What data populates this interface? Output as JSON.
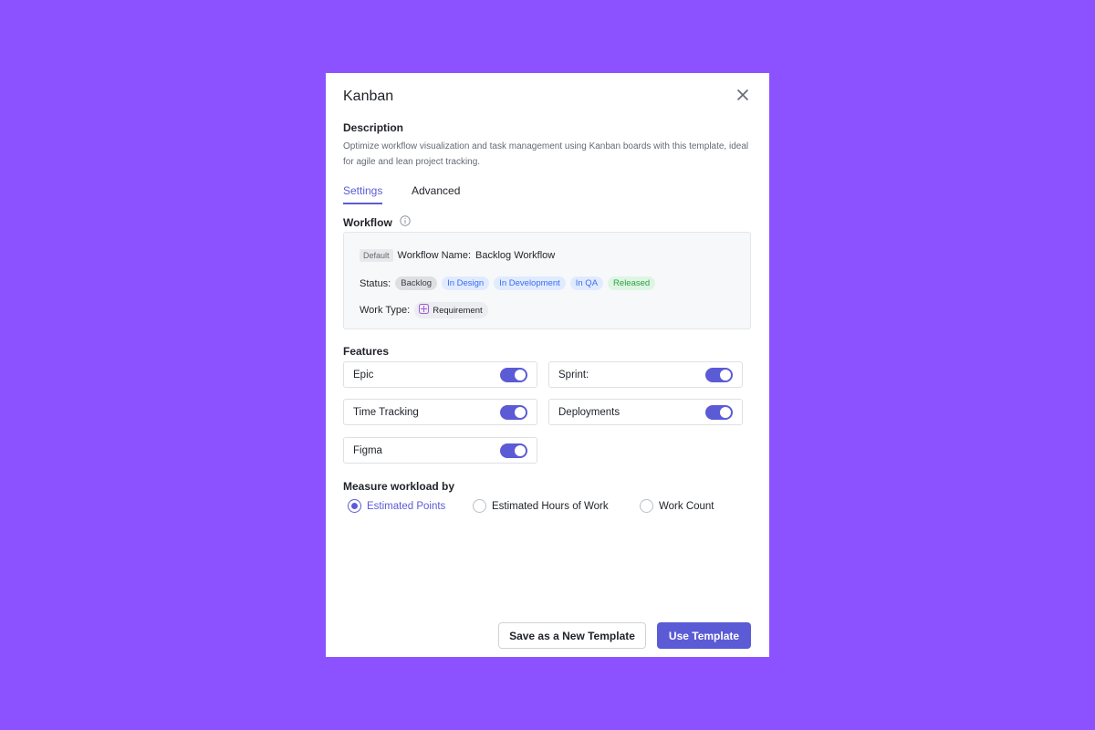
{
  "modal": {
    "title": "Kanban",
    "description_heading": "Description",
    "description": "Optimize workflow visualization and task management using Kanban boards with this template, ideal for agile and lean project tracking."
  },
  "tabs": [
    {
      "label": "Settings",
      "active": true
    },
    {
      "label": "Advanced",
      "active": false
    }
  ],
  "workflow": {
    "heading": "Workflow",
    "default_tag": "Default",
    "name_label": "Workflow Name:",
    "name_value": "Backlog Workflow",
    "status_label": "Status:",
    "statuses": [
      "Backlog",
      "In Design",
      "In Development",
      "In QA",
      "Released"
    ],
    "work_type_label": "Work Type:",
    "work_type": "Requirement"
  },
  "features": {
    "heading": "Features",
    "items": [
      {
        "label": "Epic",
        "enabled": true
      },
      {
        "label": "Sprint:",
        "enabled": true
      },
      {
        "label": "Time Tracking",
        "enabled": true
      },
      {
        "label": "Deployments",
        "enabled": true
      },
      {
        "label": "Figma",
        "enabled": true
      }
    ]
  },
  "workload": {
    "heading": "Measure workload by",
    "options": [
      {
        "label": "Estimated Points",
        "selected": true
      },
      {
        "label": "Estimated Hours of Work",
        "selected": false
      },
      {
        "label": "Work Count",
        "selected": false
      }
    ]
  },
  "footer": {
    "save_label": "Save as a New Template",
    "use_label": "Use Template"
  },
  "colors": {
    "background": "#8c52ff",
    "accent": "#5b5bd6"
  }
}
